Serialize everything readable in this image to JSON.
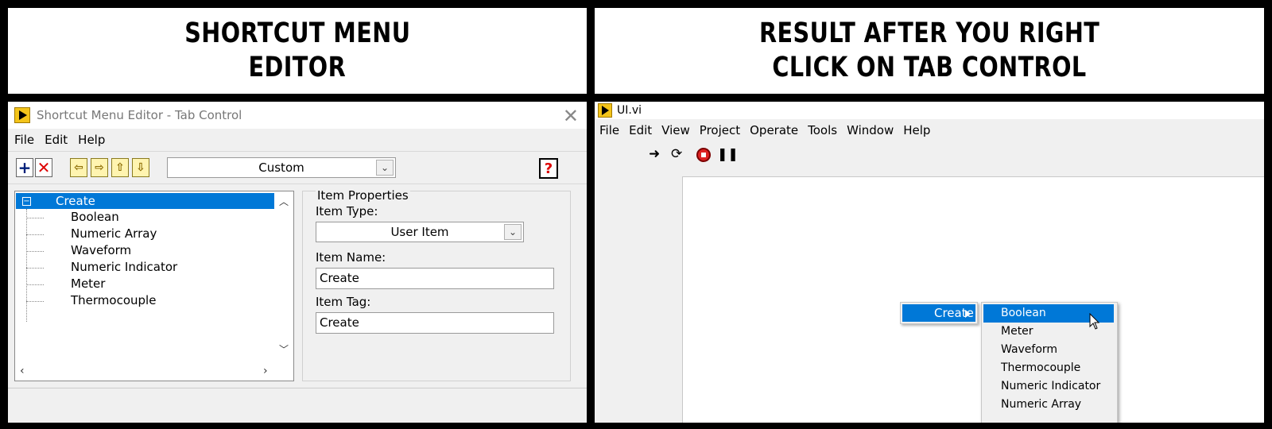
{
  "banners": {
    "left": [
      "SHORTCUT MENU",
      "EDITOR"
    ],
    "right": [
      "RESULT AFTER YOU RIGHT",
      "CLICK ON TAB CONTROL"
    ]
  },
  "editor": {
    "title": "Shortcut Menu Editor - Tab Control",
    "menu": [
      "File",
      "Edit",
      "Help"
    ],
    "toolbar": {
      "add_icon": "plus-icon",
      "delete_icon": "x-icon",
      "menu_type": "Custom",
      "help_label": "?"
    },
    "tree": {
      "root": "Create",
      "children": [
        "Boolean",
        "Numeric Array",
        "Waveform",
        "Numeric Indicator",
        "Meter",
        "Thermocouple"
      ]
    },
    "properties": {
      "group_label": "Item Properties",
      "item_type_label": "Item Type:",
      "item_type_value": "User Item",
      "item_name_label": "Item Name:",
      "item_name_value": "Create",
      "item_tag_label": "Item Tag:",
      "item_tag_value": "Create"
    }
  },
  "vi": {
    "title": "UI.vi",
    "menu": [
      "File",
      "Edit",
      "View",
      "Project",
      "Operate",
      "Tools",
      "Window",
      "Help"
    ],
    "context_menu": {
      "parent": "Create",
      "items": [
        "Boolean",
        "Meter",
        "Waveform",
        "Thermocouple",
        "Numeric Indicator",
        "Numeric Array"
      ],
      "selected": "Boolean"
    }
  },
  "colors": {
    "selection": "#0078d7",
    "window_bg": "#f0f0f0",
    "logo": "#f3c41a"
  }
}
